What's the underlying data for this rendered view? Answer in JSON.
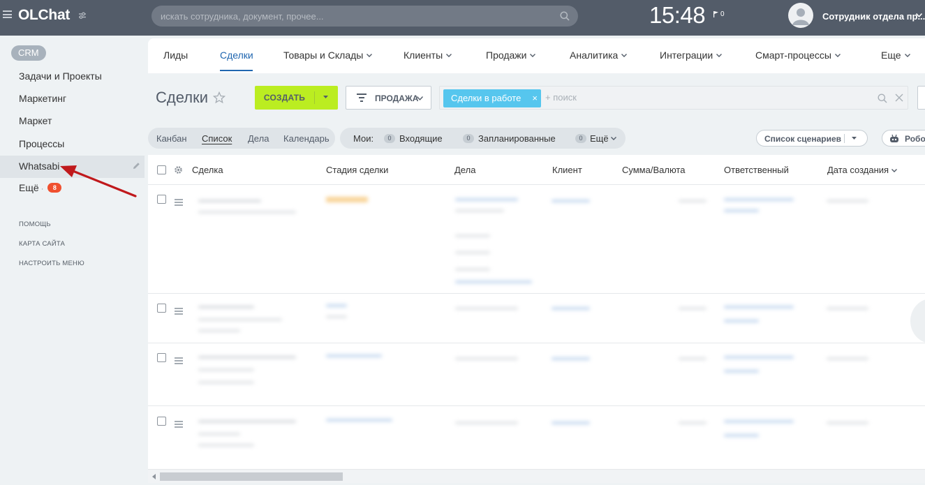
{
  "header": {
    "logo": "OLChat",
    "search_placeholder": "искать сотрудника, документ, прочее...",
    "time": "15:48",
    "flag_count": "0",
    "user_name": "Сотрудник отдела пр..."
  },
  "sidebar": {
    "crm_label": "CRM",
    "items": [
      {
        "label": "Задачи и Проекты"
      },
      {
        "label": "Маркетинг"
      },
      {
        "label": "Маркет"
      },
      {
        "label": "Процессы"
      },
      {
        "label": "Whatsabi"
      },
      {
        "label": "Ещё"
      }
    ],
    "more_badge": "8",
    "footer": {
      "help": "ПОМОЩЬ",
      "sitemap": "КАРТА САЙТА",
      "configure_menu": "НАСТРОИТЬ МЕНЮ"
    }
  },
  "nav": {
    "tabs": [
      {
        "label": "Лиды"
      },
      {
        "label": "Сделки"
      },
      {
        "label": "Товары и Склады"
      },
      {
        "label": "Клиенты"
      },
      {
        "label": "Продажи"
      },
      {
        "label": "Аналитика"
      },
      {
        "label": "Интеграции"
      },
      {
        "label": "Смарт-процессы"
      },
      {
        "label": "Еще"
      }
    ]
  },
  "toolbar": {
    "title": "Сделки",
    "create_label": "СОЗДАТЬ",
    "pipeline_label": "ПРОДАЖА",
    "filter_chip": "Сделки в работе",
    "chip_close": "×",
    "search_placeholder": "+ поиск"
  },
  "views": {
    "kanban": "Канбан",
    "list": "Список",
    "activities": "Дела",
    "calendar": "Календарь"
  },
  "counters": {
    "label": "Мои:",
    "incoming_count": "0",
    "incoming": "Входящие",
    "planned_count": "0",
    "planned": "Запланированные",
    "more_count": "0",
    "more": "Ещё"
  },
  "scenarios_label": "Список сценариев",
  "robots_label": "Робот",
  "grid": {
    "columns": [
      {
        "label": "Сделка"
      },
      {
        "label": "Стадия сделки"
      },
      {
        "label": "Дела"
      },
      {
        "label": "Клиент"
      },
      {
        "label": "Сумма/Валюта"
      },
      {
        "label": "Ответственный"
      },
      {
        "label": "Дата создания"
      }
    ]
  },
  "colors": {
    "topbar": "#535c69",
    "create_button": "#bbed21",
    "filter_chip": "#56c6ee",
    "active_tab": "#2066b0",
    "badge": "#f0502f",
    "annotation_arrow": "#c0191c"
  }
}
